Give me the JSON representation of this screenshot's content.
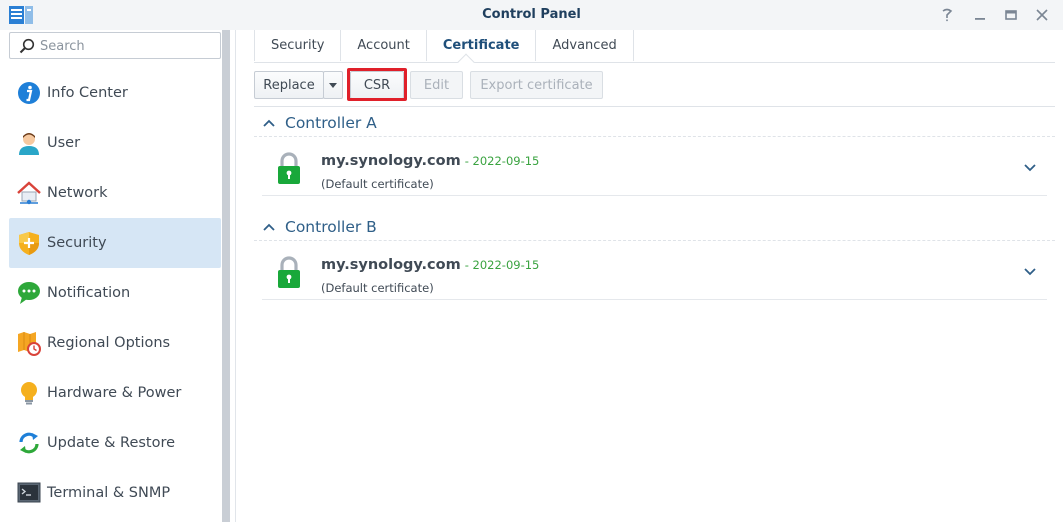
{
  "window": {
    "title": "Control Panel",
    "controls": [
      "help-icon",
      "minimize-icon",
      "maximize-icon",
      "close-icon"
    ]
  },
  "search": {
    "placeholder": "Search",
    "value": ""
  },
  "sidebar": {
    "items": [
      {
        "label": "Info Center",
        "icon": "info-icon"
      },
      {
        "label": "User",
        "icon": "user-icon"
      },
      {
        "label": "Network",
        "icon": "network-icon"
      },
      {
        "label": "Security",
        "icon": "shield-icon",
        "active": true
      },
      {
        "label": "Notification",
        "icon": "chat-bubble-icon"
      },
      {
        "label": "Regional Options",
        "icon": "map-clock-icon"
      },
      {
        "label": "Hardware & Power",
        "icon": "lightbulb-icon"
      },
      {
        "label": "Update & Restore",
        "icon": "refresh-icon"
      },
      {
        "label": "Terminal & SNMP",
        "icon": "terminal-icon"
      }
    ]
  },
  "tabs": [
    {
      "label": "Security"
    },
    {
      "label": "Account"
    },
    {
      "label": "Certificate",
      "active": true
    },
    {
      "label": "Advanced"
    }
  ],
  "toolbar": {
    "replace_label": "Replace",
    "csr_label": "CSR",
    "edit_label": "Edit",
    "export_label": "Export certificate"
  },
  "sections": [
    {
      "title": "Controller A",
      "certificate": {
        "domain": "my.synology.com",
        "date": "- 2022-09-15",
        "description": "(Default certificate)"
      }
    },
    {
      "title": "Controller B",
      "certificate": {
        "domain": "my.synology.com",
        "date": "- 2022-09-15",
        "description": "(Default certificate)"
      }
    }
  ],
  "colors": {
    "accent": "#2f5f88",
    "active_nav": "#d6e6f5",
    "highlight": "#e0202a",
    "date_green": "#3aa340",
    "lock_green": "#19a83a"
  }
}
